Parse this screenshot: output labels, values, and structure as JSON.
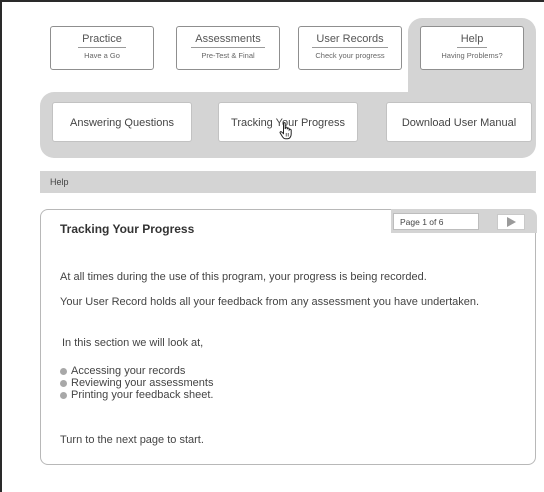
{
  "nav_tabs": [
    {
      "title": "Practice",
      "subtitle": "Have a Go"
    },
    {
      "title": "Assessments",
      "subtitle": "Pre-Test & Final"
    },
    {
      "title": "User Records",
      "subtitle": "Check your progress"
    },
    {
      "title": "Help",
      "subtitle": "Having Problems?"
    }
  ],
  "subnav": {
    "answering": "Answering Questions",
    "tracking": "Tracking Your Progress",
    "manual": "Download User Manual"
  },
  "breadcrumb": "Help",
  "panel": {
    "title": "Tracking Your Progress",
    "page_indicator": "Page 1 of 6",
    "intro": "At all times during the use of this program, your progress is being recorded.",
    "record": "Your User Record holds all your feedback from any assessment you have undertaken.",
    "section": "In this section we will look at,",
    "bullets": [
      "Accessing your records",
      "Reviewing your assessments",
      "Printing your feedback sheet."
    ],
    "turn": "Turn to the next page to start."
  },
  "colors": {
    "chrome_gray": "#d4d4d4",
    "border": "#8f8f8f",
    "text": "#444444"
  },
  "icons": [
    "hand-pointer-icon",
    "next-arrow-icon",
    "bullet-dot-icon"
  ]
}
